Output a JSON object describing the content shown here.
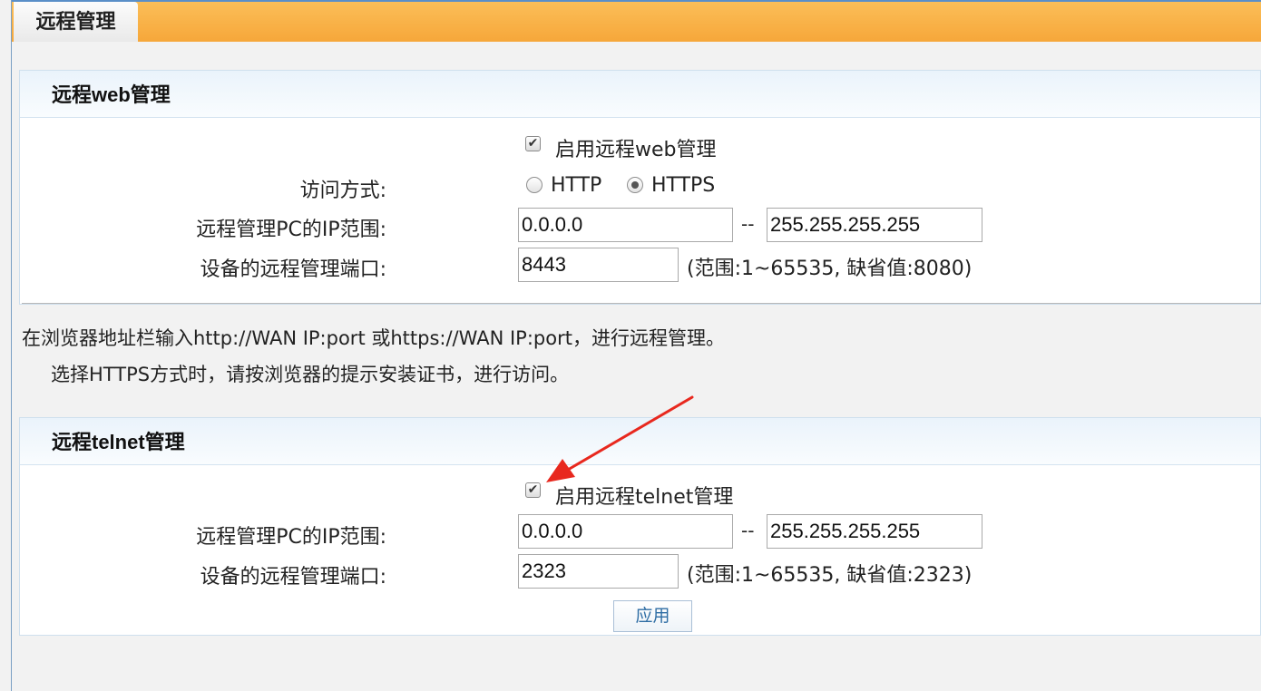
{
  "header": {
    "tab_label": "远程管理"
  },
  "web_section": {
    "title": "远程web管理",
    "enable_label": "启用远程web管理",
    "enable_checked": true,
    "access_label": "访问方式:",
    "option_http": "HTTP",
    "option_https": "HTTPS",
    "selected_access": "HTTPS",
    "ip_range_label": "远程管理PC的IP范围:",
    "ip_start": "0.0.0.0",
    "ip_separator": "--",
    "ip_end": "255.255.255.255",
    "port_label": "设备的远程管理端口:",
    "port_value": "8443",
    "port_hint": "(范围:1~65535, 缺省值:8080)"
  },
  "notes": {
    "line1": "在浏览器地址栏输入http://WAN IP:port 或https://WAN IP:port，进行远程管理。",
    "line2": "选择HTTPS方式时，请按浏览器的提示安装证书，进行访问。"
  },
  "telnet_section": {
    "title": "远程telnet管理",
    "enable_label": "启用远程telnet管理",
    "enable_checked": true,
    "ip_range_label": "远程管理PC的IP范围:",
    "ip_start": "0.0.0.0",
    "ip_separator": "--",
    "ip_end": "255.255.255.255",
    "port_label": "设备的远程管理端口:",
    "port_value": "2323",
    "port_hint": "(范围:1~65535, 缺省值:2323)",
    "apply_label": "应用"
  },
  "colors": {
    "header_bar": "#f6a73a",
    "annotation_arrow": "#e8281e",
    "button_text": "#2e6da4"
  }
}
